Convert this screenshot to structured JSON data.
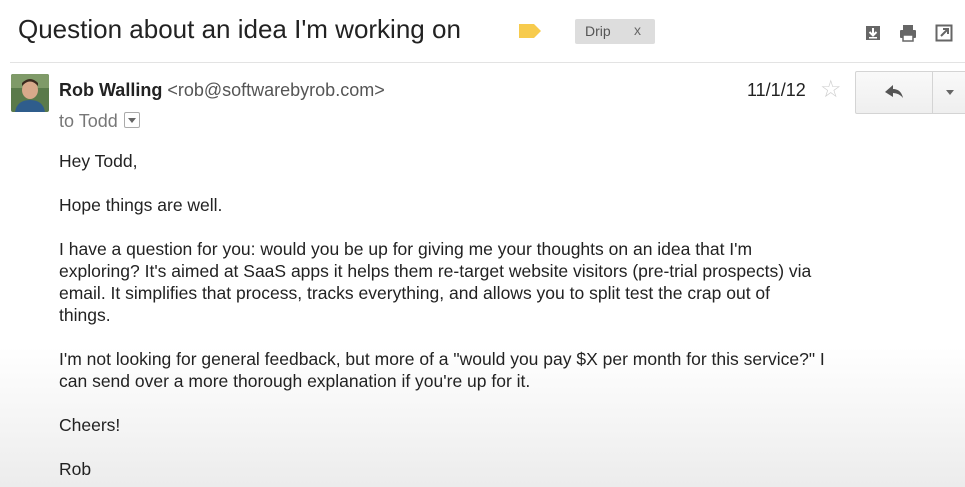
{
  "header": {
    "subject": "Question about an idea I'm working on",
    "label_chip": "Drip",
    "label_chip_remove": "x",
    "label_color": "#f7cb4d",
    "icons": [
      "download-icon",
      "print-icon",
      "new-window-icon"
    ]
  },
  "message": {
    "sender_name": "Rob Walling",
    "sender_email": "<rob@softwarebyrob.com>",
    "to_line": "to Todd",
    "date": "11/1/12",
    "star": "☆",
    "reply_icon": "reply-icon",
    "more_icon": "chevron-down-icon",
    "body": {
      "greeting": "Hey Todd,",
      "para1": "Hope things are well.",
      "para2_line1": "I have a question for you: would you be up for giving me your thoughts on an idea that I'm",
      "para2_line2": "exploring? It's aimed at SaaS apps it helps them re-target website visitors (pre-trial prospects) via",
      "para2_line3": "email. It simplifies that process, tracks everything, and allows you to split test the crap out of",
      "para2_line4": "things.",
      "para3_line1": "I'm not looking for general feedback, but more of a \"would you pay $X per month for this service?\" I",
      "para3_line2": "can send over a more thorough explanation if you're up for it.",
      "signoff": "Cheers!",
      "signature": "Rob"
    }
  }
}
